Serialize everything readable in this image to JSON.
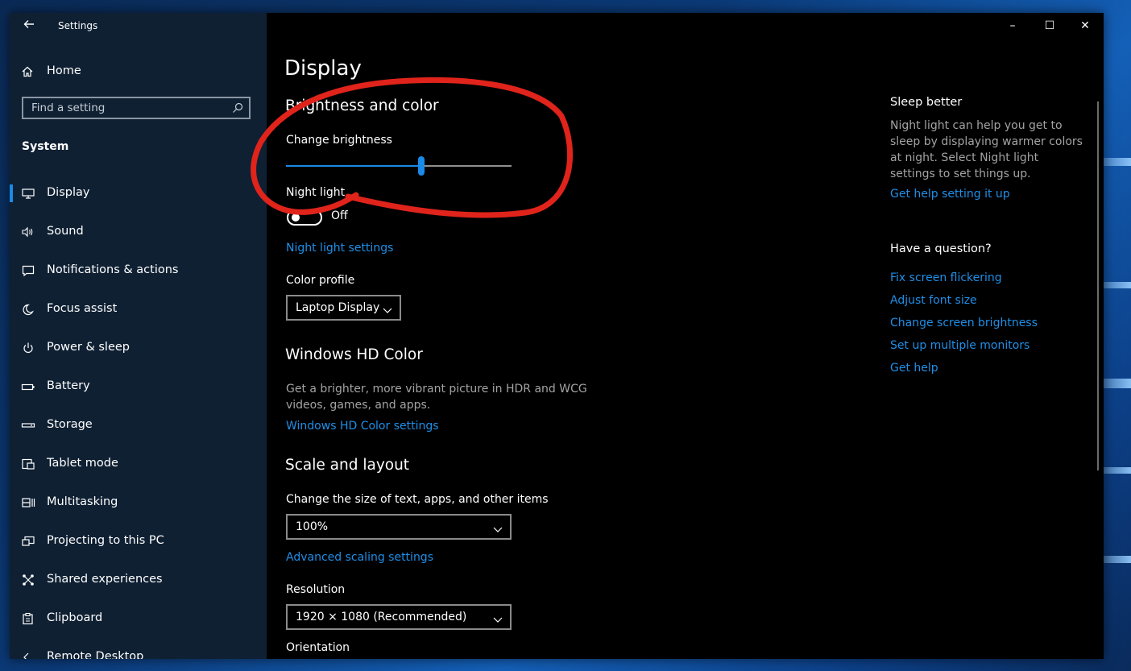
{
  "window": {
    "title": "Settings",
    "controls": {
      "minimize": "–",
      "maximize": "☐",
      "close": "✕"
    }
  },
  "sidebar": {
    "home_label": "Home",
    "search_placeholder": "Find a setting",
    "section_label": "System",
    "items": [
      {
        "label": "Display",
        "icon": "monitor-icon",
        "active": true
      },
      {
        "label": "Sound",
        "icon": "speaker-icon"
      },
      {
        "label": "Notifications & actions",
        "icon": "notification-icon"
      },
      {
        "label": "Focus assist",
        "icon": "moon-icon"
      },
      {
        "label": "Power & sleep",
        "icon": "power-icon"
      },
      {
        "label": "Battery",
        "icon": "battery-icon"
      },
      {
        "label": "Storage",
        "icon": "storage-icon"
      },
      {
        "label": "Tablet mode",
        "icon": "tablet-mode-icon"
      },
      {
        "label": "Multitasking",
        "icon": "multitasking-icon"
      },
      {
        "label": "Projecting to this PC",
        "icon": "projecting-icon"
      },
      {
        "label": "Shared experiences",
        "icon": "shared-experiences-icon"
      },
      {
        "label": "Clipboard",
        "icon": "clipboard-icon"
      },
      {
        "label": "Remote Desktop",
        "icon": "remote-desktop-icon"
      }
    ]
  },
  "main": {
    "page_title": "Display",
    "brightness": {
      "heading": "Brightness and color",
      "label": "Change brightness",
      "level": 0.6
    },
    "night_light": {
      "label": "Night light",
      "state": "Off",
      "settings_link": "Night light settings"
    },
    "color_profile": {
      "label": "Color profile",
      "value": "Laptop Display"
    },
    "hd_color": {
      "heading": "Windows HD Color",
      "description": "Get a brighter, more vibrant picture in HDR and WCG videos, games, and apps.",
      "link": "Windows HD Color settings"
    },
    "scale_layout": {
      "heading": "Scale and layout",
      "scale_label": "Change the size of text, apps, and other items",
      "scale_value": "100%",
      "advanced_link": "Advanced scaling settings",
      "resolution_label": "Resolution",
      "resolution_value": "1920 × 1080 (Recommended)",
      "orientation_label": "Orientation"
    }
  },
  "related": {
    "sleep_better": {
      "title": "Sleep better",
      "description": "Night light can help you get to sleep by displaying warmer colors at night. Select Night light settings to set things up.",
      "link": "Get help setting it up"
    },
    "question": {
      "title": "Have a question?",
      "links": [
        "Fix screen flickering",
        "Adjust font size",
        "Change screen brightness",
        "Set up multiple monitors",
        "Get help"
      ]
    }
  },
  "colors": {
    "accent": "#1a8ae8",
    "link": "#1f8fe8",
    "sidebar_bg": "#0f2033",
    "content_bg": "#000000",
    "annotation": "#e0241b"
  }
}
